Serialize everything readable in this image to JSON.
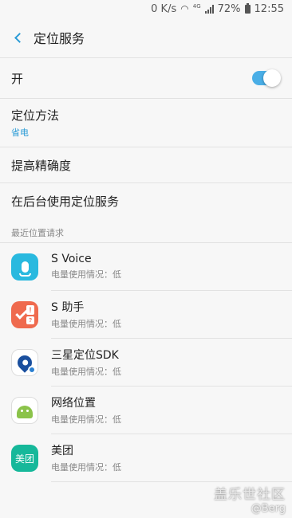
{
  "status_bar": {
    "speed": "0 K/s",
    "wifi_icon": "wifi-icon",
    "network": "4G",
    "battery": "72%",
    "time": "12:55"
  },
  "header": {
    "back_icon": "back-arrow-icon",
    "title": "定位服务"
  },
  "master_switch": {
    "label": "开",
    "on": true,
    "accent": "#4aaee6"
  },
  "settings": {
    "method_label": "定位方法",
    "method_value": "省电",
    "accuracy_label": "提高精确度",
    "background_label": "在后台使用定位服务"
  },
  "recent": {
    "section_label": "最近位置请求",
    "apps": [
      {
        "name": "S Voice",
        "usage": "电量使用情况：低",
        "icon": "s-voice-icon"
      },
      {
        "name": "S 助手",
        "usage": "电量使用情况：低",
        "icon": "s-assistant-icon"
      },
      {
        "name": "三星定位SDK",
        "usage": "电量使用情况：低",
        "icon": "samsung-location-sdk-icon"
      },
      {
        "name": "网络位置",
        "usage": "电量使用情况：低",
        "icon": "android-network-location-icon"
      },
      {
        "name": "美团",
        "usage": "电量使用情况：低",
        "icon": "meituan-icon",
        "icon_text": "美团"
      }
    ]
  },
  "watermark": {
    "line1": "盖乐世社区",
    "line2": "@Berg"
  }
}
